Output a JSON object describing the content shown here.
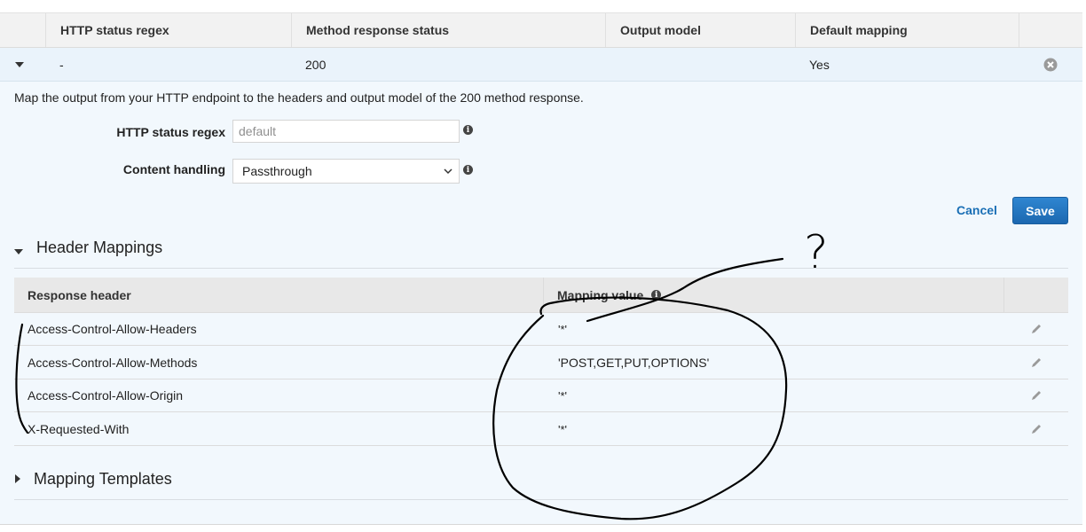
{
  "top_table": {
    "headers": [
      "HTTP status regex",
      "Method response status",
      "Output model",
      "Default mapping"
    ],
    "row": {
      "regex": "-",
      "status": "200",
      "model": "",
      "default": "Yes"
    }
  },
  "description": "Map the output from your HTTP endpoint to the headers and output model of the 200 method response.",
  "form": {
    "regex_label": "HTTP status regex",
    "regex_placeholder": "default",
    "content_label": "Content handling",
    "content_value": "Passthrough"
  },
  "actions": {
    "cancel": "Cancel",
    "save": "Save"
  },
  "header_mappings": {
    "title": "Header Mappings",
    "columns": [
      "Response header",
      "Mapping value"
    ],
    "rows": [
      {
        "header": "Access-Control-Allow-Headers",
        "value": "'*'"
      },
      {
        "header": "Access-Control-Allow-Methods",
        "value": "'POST,GET,PUT,OPTIONS'"
      },
      {
        "header": "Access-Control-Allow-Origin",
        "value": "'*'"
      },
      {
        "header": "X-Requested-With",
        "value": "'*'"
      }
    ]
  },
  "mapping_templates": {
    "title": "Mapping Templates"
  },
  "annotation": {
    "mark": "?"
  },
  "colors": {
    "accent": "#1a6fb5",
    "save_button": "#1f6fb8",
    "row_highlight": "#eaf3fb",
    "panel_bg": "#f2f8fd"
  }
}
